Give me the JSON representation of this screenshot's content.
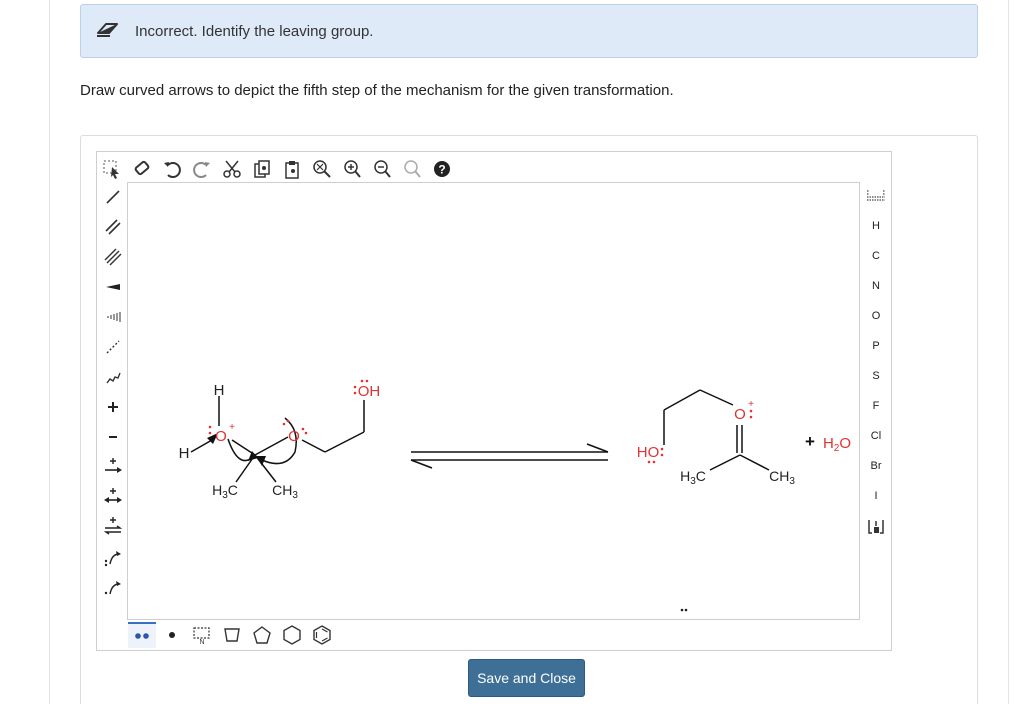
{
  "feedback": {
    "message": "Incorrect. Identify the leaving group."
  },
  "question": {
    "prompt": "Draw curved arrows to depict the fifth step of the mechanism for the given transformation."
  },
  "toolbar_top": [
    "select-tool",
    "eraser-tool",
    "undo",
    "redo",
    "cut",
    "copy",
    "paste",
    "zoom-fit",
    "zoom-in",
    "zoom-out",
    "clean",
    "help"
  ],
  "toolbar_left": [
    "single-bond",
    "double-bond",
    "triple-bond",
    "wedge-bond",
    "hash-bond",
    "dashed-bond",
    "wavy-bond",
    "positive-charge",
    "negative-charge",
    "forward-arrow",
    "equilibrium-arrow",
    "resonance-arrow",
    "retro-arrow",
    "electron-pair-arrow",
    "single-electron-arrow"
  ],
  "element_palette": {
    "items": [
      "H",
      "C",
      "N",
      "O",
      "P",
      "S",
      "F",
      "Cl",
      "Br",
      "I"
    ]
  },
  "bottom_toolbar": [
    "lone-pair",
    "radical",
    "ring-template",
    "cyclopropane",
    "cyclobutane",
    "cyclopentane",
    "cyclohexane",
    "benzene"
  ],
  "reaction": {
    "reactant": {
      "h_top": "H",
      "o_plus": "O",
      "plus": "+",
      "h_left": "H",
      "h3c": "H3C",
      "ch3": "CH3",
      "oh": "OH",
      "o_ring": "O"
    },
    "product": {
      "ho": "HO",
      "o_plus": "O",
      "plus": "+",
      "h3c": "H3C",
      "ch3": "CH3"
    },
    "byproduct": {
      "plus_sign": "+",
      "water": "H2O"
    }
  },
  "save_button": {
    "label": "Save and Close"
  },
  "colors": {
    "heteroatom": "#d33",
    "bond": "#111",
    "accent": "#3e6f96",
    "feedback_bg": "#dfeaf8"
  }
}
